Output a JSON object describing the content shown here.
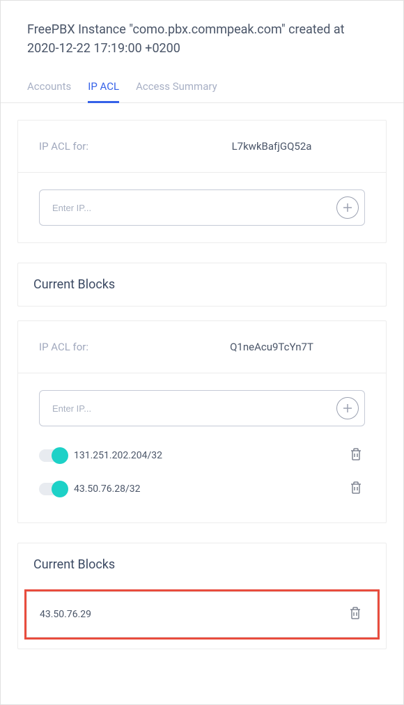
{
  "header": {
    "title": "FreePBX Instance \"como.pbx.commpeak.com\" created at 2020-12-22 17:19:00 +0200"
  },
  "tabs": {
    "accounts": "Accounts",
    "ip_acl": "IP ACL",
    "access_summary": "Access Summary"
  },
  "acl1": {
    "label": "IP ACL for:",
    "value": "L7kwkBafjGQ52a",
    "placeholder": "Enter IP..."
  },
  "blocks1_title": "Current Blocks",
  "acl2": {
    "label": "IP ACL for:",
    "value": "Q1neAcu9TcYn7T",
    "placeholder": "Enter IP...",
    "ips": [
      "131.251.202.204/32",
      "43.50.76.28/32"
    ]
  },
  "blocks2_title": "Current Blocks",
  "blocked_ip": "43.50.76.29"
}
